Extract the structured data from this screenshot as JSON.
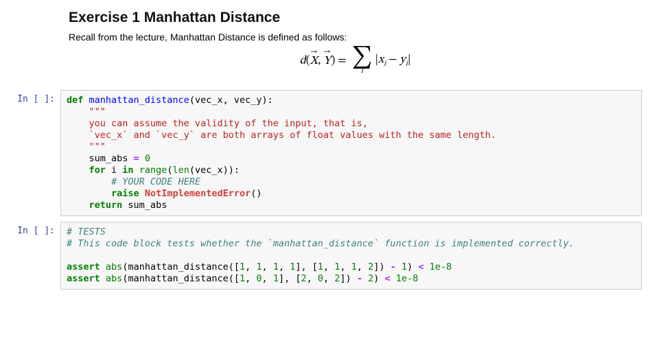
{
  "markdown": {
    "heading": "Exercise 1 Manhattan Distance",
    "intro": "Recall from the lecture, Manhattan Distance is defined as follows:",
    "formula": {
      "latex": "d(\\vec{X}, \\vec{Y}) = \\sum_i |x_i - y_i|",
      "lhs_func": "d",
      "vec1": "X",
      "vec2": "Y",
      "sum_index": "i",
      "term_x": "x",
      "term_y": "y"
    }
  },
  "cells": [
    {
      "prompt": "In [ ]:",
      "tokens": [
        {
          "t": "def ",
          "c": "kw"
        },
        {
          "t": "manhattan_distance",
          "c": "fn"
        },
        {
          "t": "(vec_x, vec_y):",
          "c": "nm"
        },
        {
          "t": "\n"
        },
        {
          "t": "    ",
          "c": "nm"
        },
        {
          "t": "\"\"\"",
          "c": "str"
        },
        {
          "t": "\n"
        },
        {
          "t": "    you can assume the validity of the input, that is,",
          "c": "str"
        },
        {
          "t": "\n"
        },
        {
          "t": "    `vec_x` and `vec_y` are both arrays of float values with the same length.",
          "c": "str"
        },
        {
          "t": "\n"
        },
        {
          "t": "    \"\"\"",
          "c": "str"
        },
        {
          "t": "\n"
        },
        {
          "t": "    sum_abs ",
          "c": "nm"
        },
        {
          "t": "=",
          "c": "op"
        },
        {
          "t": " ",
          "c": "nm"
        },
        {
          "t": "0",
          "c": "num"
        },
        {
          "t": "\n"
        },
        {
          "t": "    ",
          "c": "nm"
        },
        {
          "t": "for",
          "c": "kw"
        },
        {
          "t": " i ",
          "c": "nm"
        },
        {
          "t": "in",
          "c": "kw"
        },
        {
          "t": " ",
          "c": "nm"
        },
        {
          "t": "range",
          "c": "bi"
        },
        {
          "t": "(",
          "c": "nm"
        },
        {
          "t": "len",
          "c": "bi"
        },
        {
          "t": "(vec_x)):",
          "c": "nm"
        },
        {
          "t": "\n"
        },
        {
          "t": "        ",
          "c": "nm"
        },
        {
          "t": "# YOUR CODE HERE",
          "c": "cmt"
        },
        {
          "t": "\n"
        },
        {
          "t": "        ",
          "c": "nm"
        },
        {
          "t": "raise",
          "c": "kw"
        },
        {
          "t": " ",
          "c": "nm"
        },
        {
          "t": "NotImplementedError",
          "c": "err"
        },
        {
          "t": "()",
          "c": "nm"
        },
        {
          "t": "\n"
        },
        {
          "t": "    ",
          "c": "nm"
        },
        {
          "t": "return",
          "c": "kw"
        },
        {
          "t": " sum_abs",
          "c": "nm"
        }
      ]
    },
    {
      "prompt": "In [ ]:",
      "tokens": [
        {
          "t": "# TESTS",
          "c": "cmt"
        },
        {
          "t": "\n"
        },
        {
          "t": "# This code block tests whether the `manhattan_distance` function is implemented correctly.",
          "c": "cmt"
        },
        {
          "t": "\n"
        },
        {
          "t": "\n"
        },
        {
          "t": "assert",
          "c": "kw"
        },
        {
          "t": " ",
          "c": "nm"
        },
        {
          "t": "abs",
          "c": "bi"
        },
        {
          "t": "(manhattan_distance([",
          "c": "nm"
        },
        {
          "t": "1",
          "c": "num"
        },
        {
          "t": ", ",
          "c": "nm"
        },
        {
          "t": "1",
          "c": "num"
        },
        {
          "t": ", ",
          "c": "nm"
        },
        {
          "t": "1",
          "c": "num"
        },
        {
          "t": ", ",
          "c": "nm"
        },
        {
          "t": "1",
          "c": "num"
        },
        {
          "t": "], [",
          "c": "nm"
        },
        {
          "t": "1",
          "c": "num"
        },
        {
          "t": ", ",
          "c": "nm"
        },
        {
          "t": "1",
          "c": "num"
        },
        {
          "t": ", ",
          "c": "nm"
        },
        {
          "t": "1",
          "c": "num"
        },
        {
          "t": ", ",
          "c": "nm"
        },
        {
          "t": "2",
          "c": "num"
        },
        {
          "t": "]) ",
          "c": "nm"
        },
        {
          "t": "-",
          "c": "op"
        },
        {
          "t": " ",
          "c": "nm"
        },
        {
          "t": "1",
          "c": "num"
        },
        {
          "t": ") ",
          "c": "nm"
        },
        {
          "t": "<",
          "c": "op"
        },
        {
          "t": " ",
          "c": "nm"
        },
        {
          "t": "1e-8",
          "c": "num"
        },
        {
          "t": "\n"
        },
        {
          "t": "assert",
          "c": "kw"
        },
        {
          "t": " ",
          "c": "nm"
        },
        {
          "t": "abs",
          "c": "bi"
        },
        {
          "t": "(manhattan_distance([",
          "c": "nm"
        },
        {
          "t": "1",
          "c": "num"
        },
        {
          "t": ", ",
          "c": "nm"
        },
        {
          "t": "0",
          "c": "num"
        },
        {
          "t": ", ",
          "c": "nm"
        },
        {
          "t": "1",
          "c": "num"
        },
        {
          "t": "], [",
          "c": "nm"
        },
        {
          "t": "2",
          "c": "num"
        },
        {
          "t": ", ",
          "c": "nm"
        },
        {
          "t": "0",
          "c": "num"
        },
        {
          "t": ", ",
          "c": "nm"
        },
        {
          "t": "2",
          "c": "num"
        },
        {
          "t": "]) ",
          "c": "nm"
        },
        {
          "t": "-",
          "c": "op"
        },
        {
          "t": " ",
          "c": "nm"
        },
        {
          "t": "2",
          "c": "num"
        },
        {
          "t": ") ",
          "c": "nm"
        },
        {
          "t": "<",
          "c": "op"
        },
        {
          "t": " ",
          "c": "nm"
        },
        {
          "t": "1e-8",
          "c": "num"
        }
      ]
    }
  ]
}
